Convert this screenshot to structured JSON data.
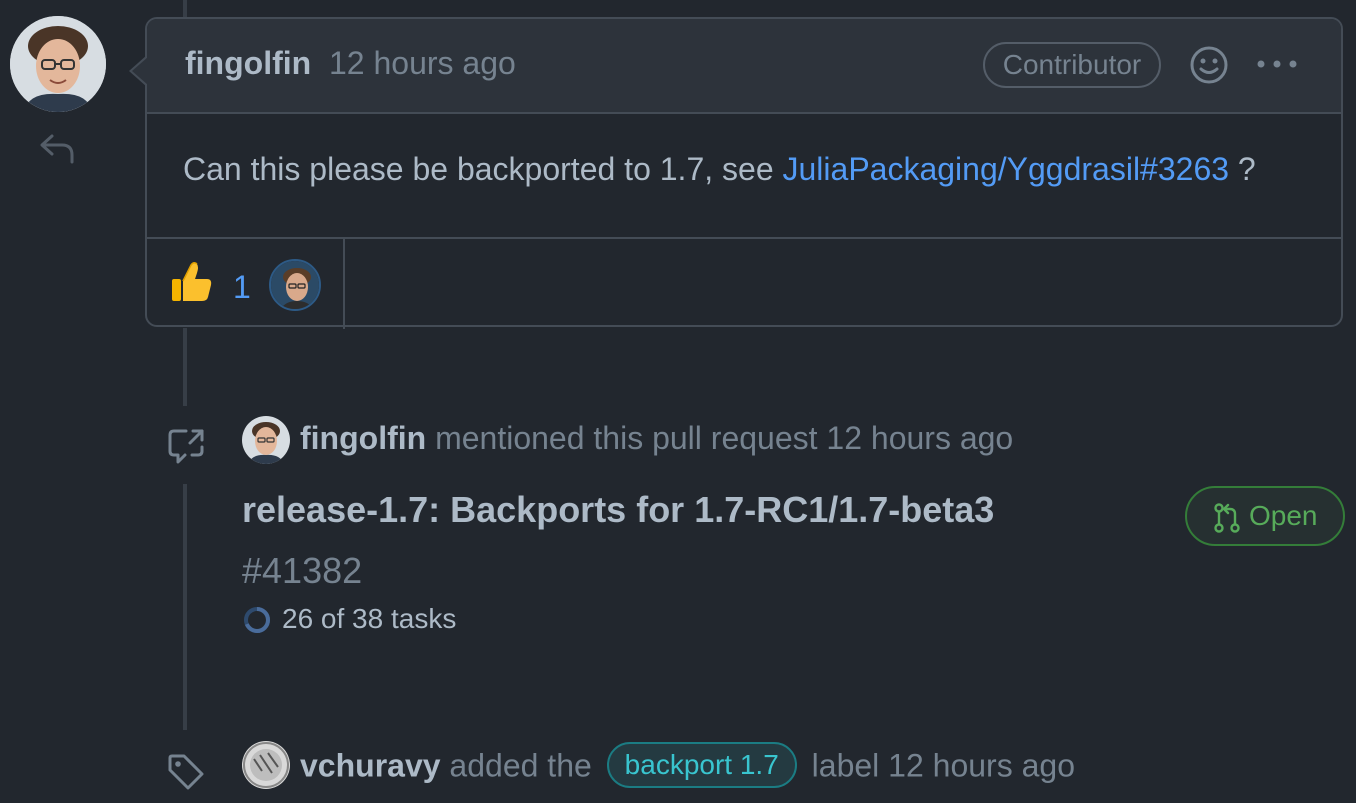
{
  "comment": {
    "author": "fingolfin",
    "time": "12 hours ago",
    "role_badge": "Contributor",
    "body_before": "Can this please be backported to 1.7, see ",
    "body_link": "JuliaPackaging/Yggdrasil#3263",
    "body_after": " ?",
    "reactions": [
      {
        "emoji": "thumbs-up",
        "count": "1"
      }
    ]
  },
  "mention_event": {
    "actor": "fingolfin",
    "action": "mentioned this pull request",
    "time": "12 hours ago",
    "pr_title": "release-1.7: Backports for 1.7-RC1/1.7-beta3",
    "pr_number": "#41382",
    "tasks": "26 of 38 tasks",
    "tasks_progress": 0.684,
    "status": "Open"
  },
  "label_event": {
    "actor": "vchuravy",
    "action": "added the",
    "label": "backport 1.7",
    "suffix": "label",
    "time": "12 hours ago"
  },
  "colors": {
    "background": "#22272e",
    "link": "#539bf5",
    "open_green": "#57ab5a",
    "label_cyan": "#39c5cf"
  }
}
